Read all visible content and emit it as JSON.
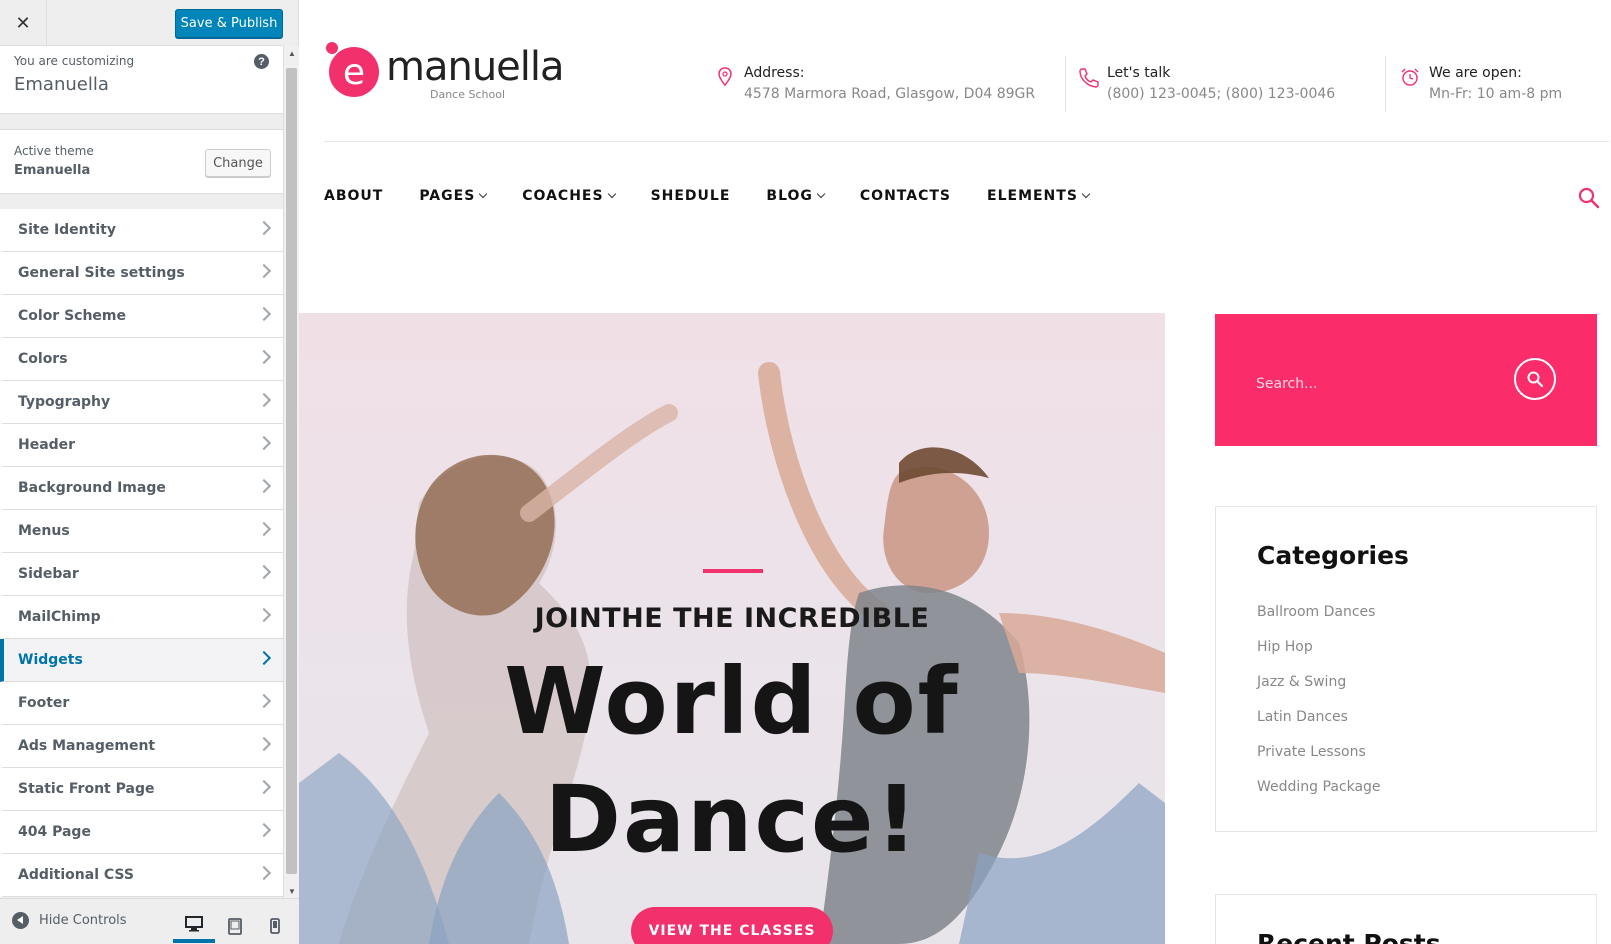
{
  "customizer": {
    "close_glyph": "✕",
    "save_label": "Save & Publish",
    "customizing_label": "You are customizing",
    "site_name": "Emanuella",
    "help_glyph": "?",
    "active_theme_label": "Active theme",
    "active_theme_name": "Emanuella",
    "change_label": "Change",
    "panels": [
      {
        "label": "Site Identity"
      },
      {
        "label": "General Site settings"
      },
      {
        "label": "Color Scheme"
      },
      {
        "label": "Colors"
      },
      {
        "label": "Typography"
      },
      {
        "label": "Header"
      },
      {
        "label": "Background Image"
      },
      {
        "label": "Menus"
      },
      {
        "label": "Sidebar"
      },
      {
        "label": "MailChimp"
      },
      {
        "label": "Widgets"
      },
      {
        "label": "Footer"
      },
      {
        "label": "Ads Management"
      },
      {
        "label": "Static Front Page"
      },
      {
        "label": "404 Page"
      },
      {
        "label": "Additional CSS"
      }
    ],
    "active_panel": "Widgets",
    "hide_controls_label": "Hide Controls",
    "devices": [
      "desktop-icon",
      "tablet-icon",
      "mobile-icon"
    ],
    "active_device": "desktop",
    "accent": "#0085ba"
  },
  "site": {
    "logo_letter": "e",
    "logo_name": "manuella",
    "logo_tagline": "Dance School",
    "brand_color": "#f2306c",
    "address": {
      "label": "Address:",
      "value": "4578 Marmora Road, Glasgow, D04 89GR",
      "icon": "map-pin-icon"
    },
    "phone": {
      "label": "Let's talk",
      "value": "(800) 123-0045; (800) 123-0046",
      "icon": "phone-icon"
    },
    "hours": {
      "label": "We are open:",
      "value": "Mn-Fr: 10 am-8 pm",
      "icon": "alarm-clock-icon"
    },
    "nav": [
      {
        "label": "ABOUT",
        "dropdown": false
      },
      {
        "label": "PAGES",
        "dropdown": true
      },
      {
        "label": "COACHES",
        "dropdown": true
      },
      {
        "label": "SHEDULE",
        "dropdown": false
      },
      {
        "label": "BLOG",
        "dropdown": true
      },
      {
        "label": "CONTACTS",
        "dropdown": false
      },
      {
        "label": "ELEMENTS",
        "dropdown": true
      }
    ],
    "hero": {
      "kicker": "JOINTHE THE INCREDIBLE",
      "title_line1": "World of",
      "title_line2": "Dance!",
      "button_label": "VIEW THE CLASSES"
    },
    "search_widget": {
      "placeholder": "Search..."
    },
    "categories_widget": {
      "title": "Categories",
      "items": [
        "Ballroom Dances",
        "Hip Hop",
        "Jazz & Swing",
        "Latin Dances",
        "Private Lessons",
        "Wedding Package"
      ]
    },
    "recent_posts_widget": {
      "title": "Recent Posts"
    }
  }
}
